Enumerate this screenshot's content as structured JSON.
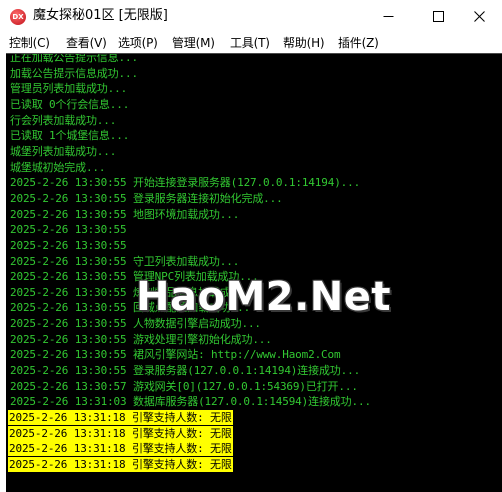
{
  "window": {
    "icon_label": "DX",
    "title": "魔女探秘01区 [无限版]",
    "minimize_glyph": "—",
    "maximize_glyph": "☐",
    "close_glyph": "✕"
  },
  "menu": [
    "控制(C)",
    "查看(V)",
    "选项(P)",
    "管理(M)",
    "工具(T)",
    "帮助(H)",
    "插件(Z)"
  ],
  "console": {
    "lines": [
      "正在加载公告提示信息...",
      "加载公告提示信息成功...",
      "管理员列表加载成功...",
      "已读取 0个行会信息...",
      "行会列表加载成功...",
      "已读取 1个城堡信息...",
      "城堡列表加载成功...",
      "城堡城初始完成...",
      "2025-2-26 13:30:55 开始连接登录服务器(127.0.0.1:14194)...",
      "2025-2-26 13:30:55 登录服务器连接初始化完成...",
      "2025-2-26 13:30:55 地图环境加载成功...",
      "2025-2-26 13:30:55",
      "2025-2-26 13:30:55",
      "2025-2-26 13:30:55 守卫列表加载成功...",
      "2025-2-26 13:30:55 管理NPC列表加载成功...",
      "2025-2-26 13:30:55 炼制物品信息加载成功...",
      "2025-2-26 13:30:55 回城点配置加载成功...",
      "2025-2-26 13:30:55 人物数据引擎启动成功...",
      "2025-2-26 13:30:55 游戏处理引擎初始化成功...",
      "2025-2-26 13:30:55 裙风引擎网站: http://www.Haom2.Com",
      "2025-2-26 13:30:55 登录服务器(127.0.0.1:14194)连接成功...",
      "2025-2-26 13:30:57 游戏网关[0](127.0.0.1:54369)已打开...",
      "2025-2-26 13:31:03 数据库服务器(127.0.0.1:14594)连接成功..."
    ],
    "highlighted_lines": [
      "2025-2-26 13:31:18 引擎支持人数: 无限",
      "2025-2-26 13:31:18 引擎支持人数: 无限",
      "2025-2-26 13:31:18 引擎支持人数: 无限",
      "2025-2-26 13:31:18 引擎支持人数: 无限"
    ],
    "text_color": "#32c832",
    "highlight_color": "#ffff00"
  },
  "watermark": "HaoM2.Net"
}
